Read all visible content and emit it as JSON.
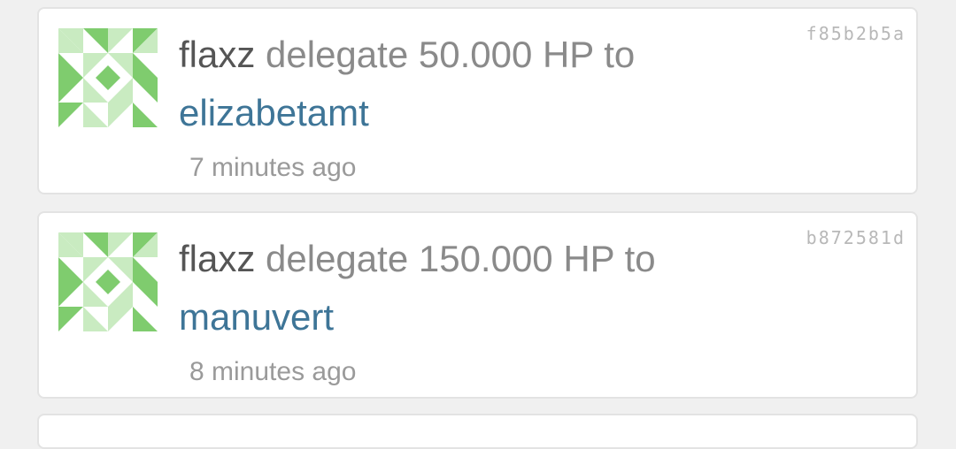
{
  "colors": {
    "background": "#f0f0f0",
    "card": "#ffffff",
    "actor_text": "#555555",
    "action_text": "#8a8a8a",
    "target_link": "#3e7597",
    "timestamp": "#9a9a9a",
    "hash": "#b8b8b8",
    "avatar_dark": "#7fcc6e",
    "avatar_light": "#c9ebc1"
  },
  "feed": {
    "items": [
      {
        "avatar_icon": "identicon-avatar",
        "actor": "flaxz",
        "action": " delegate 50.000 HP to",
        "target": "elizabetamt",
        "time": "7 minutes ago",
        "hash": "f85b2b5a"
      },
      {
        "avatar_icon": "identicon-avatar",
        "actor": "flaxz",
        "action": " delegate 150.000 HP to",
        "target": "manuvert",
        "time": "8 minutes ago",
        "hash": "b872581d"
      }
    ]
  }
}
